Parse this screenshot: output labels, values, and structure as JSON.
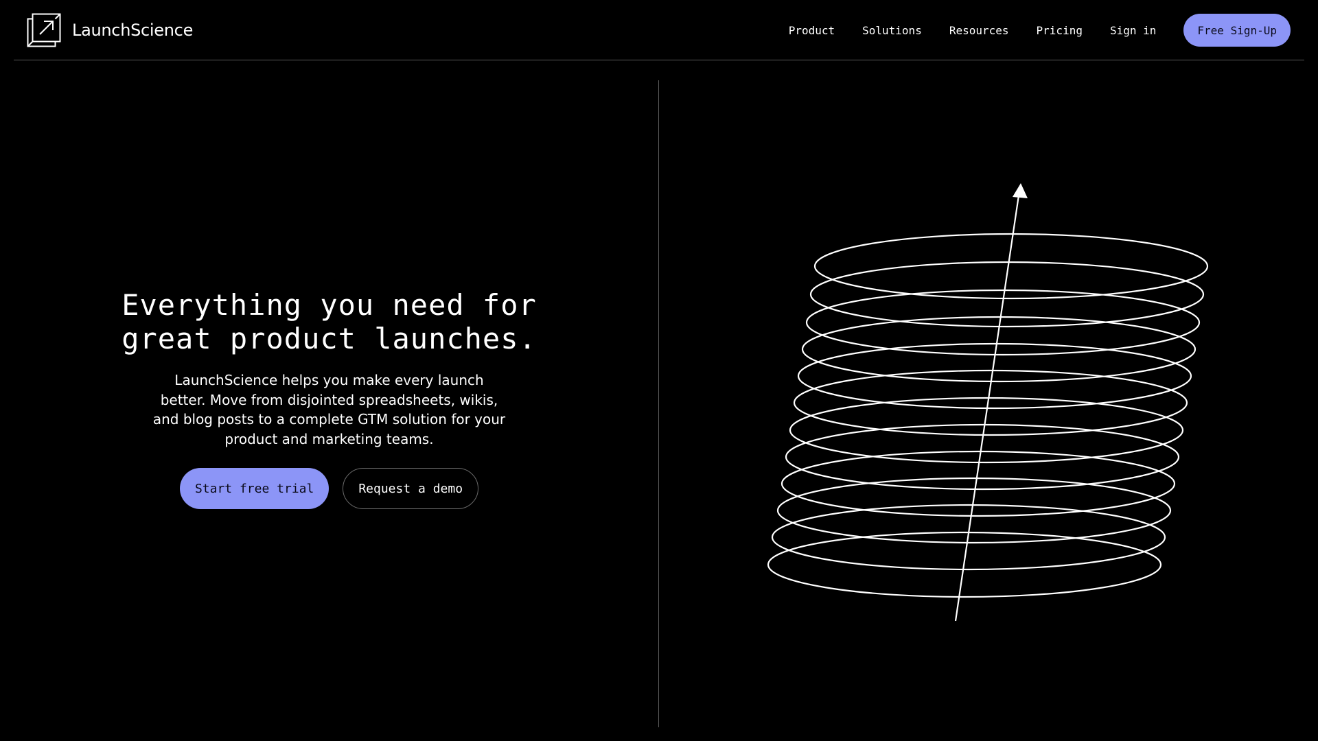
{
  "brand": {
    "name": "LaunchScience",
    "logo_icon": "launch-box-icon"
  },
  "nav": {
    "items": [
      {
        "label": "Product"
      },
      {
        "label": "Solutions"
      },
      {
        "label": "Resources"
      },
      {
        "label": "Pricing"
      },
      {
        "label": "Sign in"
      }
    ],
    "cta_label": "Free Sign-Up"
  },
  "hero": {
    "title_line1": "Everything you need for",
    "title_line2": "great product launches.",
    "subtitle": "LaunchScience helps you make every launch better. Move from disjointed spreadsheets, wikis, and blog posts to a complete GTM solution for your product and marketing teams.",
    "primary_cta": "Start free trial",
    "secondary_cta": "Request a demo"
  },
  "illustration": {
    "icon": "spiral-arrow-icon"
  },
  "colors": {
    "background": "#000000",
    "text": "#ffffff",
    "accent": "#8c95f7",
    "rule": "#5a5a5a"
  }
}
